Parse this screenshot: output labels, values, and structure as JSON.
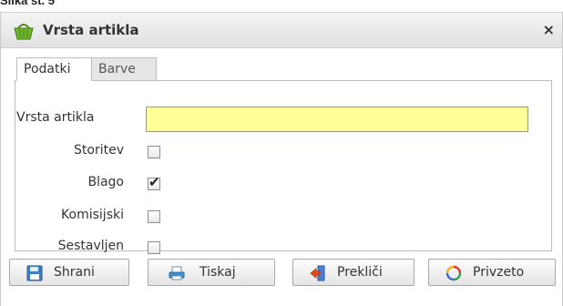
{
  "caption": "Slika št. 5",
  "dialog": {
    "title": "Vrsta artikla",
    "close": "×"
  },
  "tabs": [
    {
      "label": "Podatki",
      "active": true
    },
    {
      "label": "Barve",
      "active": false
    }
  ],
  "form": {
    "name_label": "Vrsta artikla",
    "name_value": "",
    "name_bg": "#ffff99",
    "checks": [
      {
        "label": "Storitev",
        "checked": false
      },
      {
        "label": "Blago",
        "checked": true
      },
      {
        "label": "Komisijski",
        "checked": false
      },
      {
        "label": "Sestavljen",
        "checked": false
      }
    ]
  },
  "buttons": {
    "save": {
      "label": "Shrani",
      "icon": "floppy-disk-icon"
    },
    "print": {
      "label": "Tiskaj",
      "icon": "printer-icon"
    },
    "cancel": {
      "label": "Prekliči",
      "icon": "exit-arrow-icon"
    },
    "defaults": {
      "label": "Privzeto",
      "icon": "refresh-icon"
    }
  }
}
